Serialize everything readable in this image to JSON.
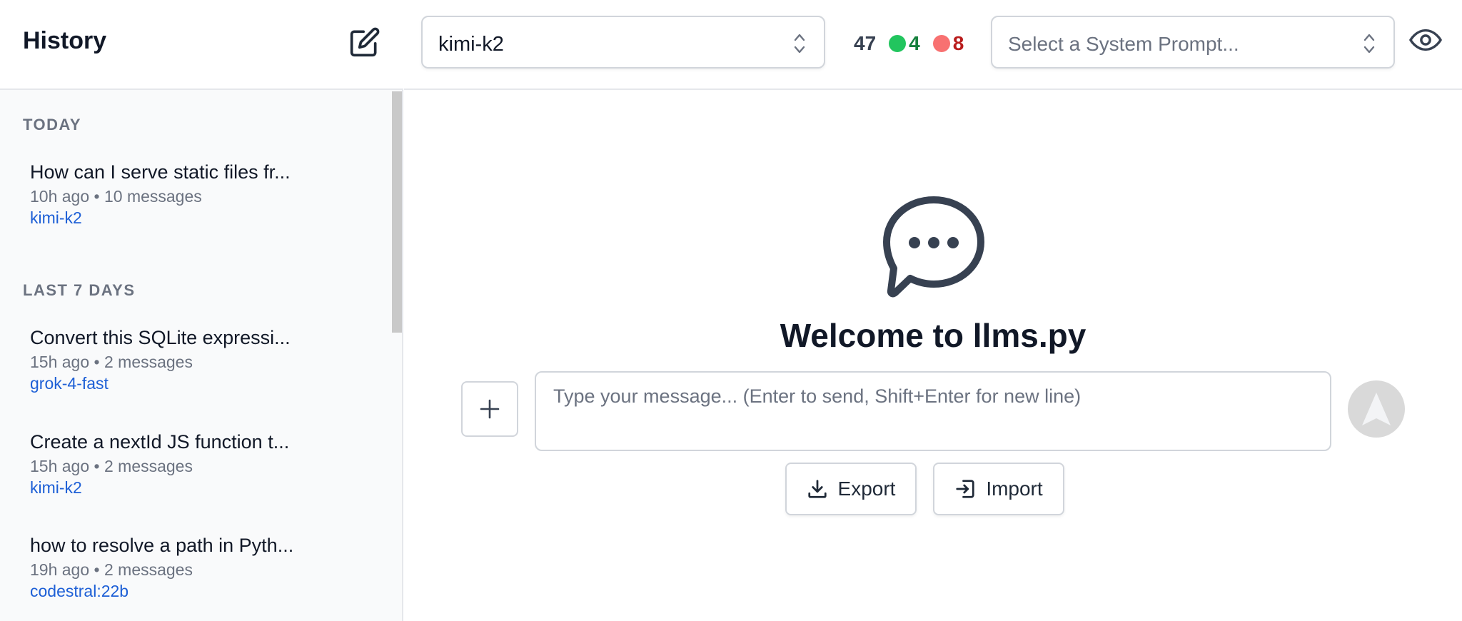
{
  "sidebar": {
    "title": "History",
    "sections": [
      {
        "label": "TODAY",
        "threads": [
          {
            "title": "How can I serve static files fr...",
            "meta": "10h ago • 10 messages",
            "model": "kimi-k2"
          }
        ]
      },
      {
        "label": "LAST 7 DAYS",
        "threads": [
          {
            "title": "Convert this SQLite expressi...",
            "meta": "15h ago • 2 messages",
            "model": "grok-4-fast"
          },
          {
            "title": "Create a nextId JS function t...",
            "meta": "15h ago • 2 messages",
            "model": "kimi-k2"
          },
          {
            "title": "how to resolve a path in Pyth...",
            "meta": "19h ago • 2 messages",
            "model": "codestral:22b"
          }
        ]
      }
    ]
  },
  "topbar": {
    "model_select": {
      "value": "kimi-k2"
    },
    "stats": {
      "total": "47",
      "success": "4",
      "errors": "8"
    },
    "system_prompt_select": {
      "placeholder": "Select a System Prompt..."
    }
  },
  "main": {
    "welcome": "Welcome to llms.py",
    "input_placeholder": "Type your message... (Enter to send, Shift+Enter for new line)",
    "export_label": "Export",
    "import_label": "Import"
  },
  "icons": {
    "new_chat": "edit-icon",
    "eye": "eye-icon",
    "chat": "chat-bubble-icon",
    "plus": "plus-icon",
    "send": "send-icon",
    "download": "download-icon",
    "import": "import-icon"
  },
  "colors": {
    "success_dot": "#22c55e",
    "error_dot": "#f87171",
    "success_text": "#15803d",
    "error_text": "#b91c1c",
    "model_link": "#1d5fd6"
  }
}
